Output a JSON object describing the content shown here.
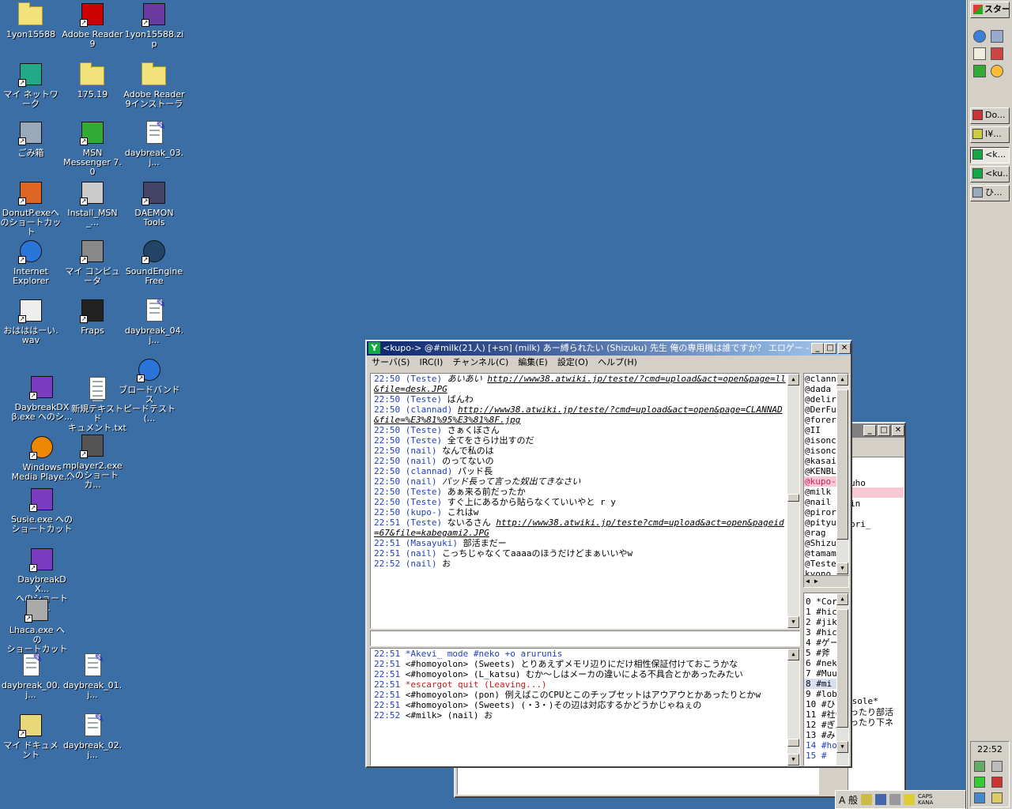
{
  "desktop": {
    "icons": [
      {
        "id": "i0",
        "label": "1yon15588",
        "type": "folder"
      },
      {
        "id": "i1",
        "label": "Adobe Reader\n9",
        "type": "pdf"
      },
      {
        "id": "i2",
        "label": "1yon15588.zip",
        "type": "zip"
      },
      {
        "id": "i3",
        "label": "マイ ネットワーク",
        "type": "network"
      },
      {
        "id": "i4",
        "label": "175.19",
        "type": "folder"
      },
      {
        "id": "i5",
        "label": "Adobe Reader\n9インストーラ",
        "type": "folder"
      },
      {
        "id": "i6",
        "label": "ごみ箱",
        "type": "trash"
      },
      {
        "id": "i7",
        "label": "MSN\nMessenger 7.0",
        "type": "msn"
      },
      {
        "id": "i8",
        "label": "daybreak_03.j...",
        "type": "image"
      },
      {
        "id": "i9",
        "label": "DonutP.exeへ\nのショートカット",
        "type": "donut"
      },
      {
        "id": "i10",
        "label": "Install_MSN_...",
        "type": "installer"
      },
      {
        "id": "i11",
        "label": "DAEMON\nTools",
        "type": "daemon"
      },
      {
        "id": "i12",
        "label": "Internet\nExplorer",
        "type": "ie"
      },
      {
        "id": "i13",
        "label": "マイ コンピュータ",
        "type": "computer"
      },
      {
        "id": "i14",
        "label": "SoundEngine\nFree",
        "type": "sound"
      },
      {
        "id": "i15",
        "label": "おはははーい.\nwav",
        "type": "wav"
      },
      {
        "id": "i16",
        "label": "Fraps",
        "type": "fraps"
      },
      {
        "id": "i17",
        "label": "daybreak_04.j...",
        "type": "image"
      },
      {
        "id": "i18",
        "label": "DaybreakDX\nβ.exe へのシ...",
        "type": "anime"
      },
      {
        "id": "i19",
        "label": "新規テキスト ド\nキュメント.txt",
        "type": "text"
      },
      {
        "id": "i20",
        "label": "ブロードバンドス\nピードテスト(...",
        "type": "ie"
      },
      {
        "id": "i21",
        "label": "Windows\nMedia Playe...",
        "type": "wmp"
      },
      {
        "id": "i22",
        "label": "mplayer2.exe\nへのショートカ...",
        "type": "mplayer"
      },
      {
        "id": "i23",
        "label": "Susie.exe への\nショートカット",
        "type": "anime"
      },
      {
        "id": "i24",
        "label": "DaybreakDX...\nへのショートカ...",
        "type": "anime"
      },
      {
        "id": "i25",
        "label": "Lhaca.exe への\nショートカット",
        "type": "lhaca"
      },
      {
        "id": "i26",
        "label": "daybreak_00.j...",
        "type": "image"
      },
      {
        "id": "i27",
        "label": "daybreak_01.j...",
        "type": "image"
      },
      {
        "id": "i28",
        "label": "マイ ドキュメント",
        "type": "mydocs"
      },
      {
        "id": "i29",
        "label": "daybreak_02.j...",
        "type": "image"
      }
    ]
  },
  "taskbar": {
    "start_label": "スタート",
    "buttons": [
      "Do...",
      "I¥...",
      "<k...",
      "<ku...",
      "ひ..."
    ],
    "clock": "22:52",
    "ime": "A 般",
    "caps": "CAPS",
    "kana": "KANA"
  },
  "chat": {
    "title": "<kupo-> @#milk(21人) [+sn] (milk) あー縛られたい (Shizuku) 先生 俺の専用機は誰ですか？ エロゲー - Li...",
    "menu": [
      "サーバ(S)",
      "IRC(I)",
      "チャンネル(C)",
      "編集(E)",
      "設定(O)",
      "ヘルプ(H)"
    ],
    "main_log": [
      {
        "t": "22:50",
        "n": "(Teste)",
        "m": "あいあい ",
        "u": "http://www38.atwiki.jp/teste/?cmd=upload&act=open&page=ll&file=desk.JPG",
        "st": "it"
      },
      {
        "t": "22:50",
        "n": "(Teste)",
        "m": "ばんわ"
      },
      {
        "t": "22:50",
        "n": "(clannad)",
        "m": "",
        "u": "http://www38.atwiki.jp/teste/?cmd=upload&act=open&page=CLANNAD&file=%E3%81%95%E3%81%8F.jpg"
      },
      {
        "t": "22:50",
        "n": "(Teste)",
        "m": "さぁくぼさん"
      },
      {
        "t": "22:50",
        "n": "(Teste)",
        "m": "全てをさらけ出すのだ"
      },
      {
        "t": "22:50",
        "n": "(nail)",
        "m": "なんで私のは"
      },
      {
        "t": "22:50",
        "n": "(nail)",
        "m": "のってないの"
      },
      {
        "t": "22:50",
        "n": "(clannad)",
        "m": "パッド長"
      },
      {
        "t": "22:50",
        "n": "(nail)",
        "m": "パッド長って言った奴出てきなさい",
        "st": "it"
      },
      {
        "t": "22:50",
        "n": "(Teste)",
        "m": "あぁ来る前だったか"
      },
      {
        "t": "22:50",
        "n": "(Teste)",
        "m": "すぐ上にあるから貼らなくていいやと r y"
      },
      {
        "t": "22:50",
        "n": "(kupo-)",
        "m": "これはw"
      },
      {
        "t": "22:51",
        "n": "(Teste)",
        "m": "ないるさん ",
        "u": "http://www38.atwiki.jp/teste?cmd=upload&act=open&pageid=67&file=kabegami2.JPG"
      },
      {
        "t": "22:51",
        "n": "(Masayuki)",
        "m": "部活まだー"
      },
      {
        "t": "22:51",
        "n": "(nail)",
        "m": "こっちじゃなくてaaaaのほうだけどまぁいいやw"
      },
      {
        "t": "22:52",
        "n": "(nail)",
        "m": "お"
      }
    ],
    "sub_log": [
      {
        "t": "22:51",
        "m": "*Akevi_ mode #neko +o arurunis",
        "cls": "nk"
      },
      {
        "t": "22:51",
        "m": "<#homoyolon> (Sweets) とりあえずメモリ辺りにだけ相性保証付けておこうかな"
      },
      {
        "t": "22:51",
        "m": "<#homoyolon> (L_katsu) むか～しはメーカの違いによる不具合とかあったみたい"
      },
      {
        "t": "22:51",
        "m": "*escargot quit (Leaving...)",
        "cls": "red"
      },
      {
        "t": "22:51",
        "m": "<#homoyolon> (pon) 例えばこのCPUとこのチップセットはアウアウとかあったりとかw"
      },
      {
        "t": "22:51",
        "m": "<#homoyolon> (Sweets) (・3・)その辺は対応するかどうかじゃねぇの"
      },
      {
        "t": "22:52",
        "m": "<#milk> (nail) お"
      }
    ],
    "nicks": [
      "@clann",
      "@dada",
      "@delir",
      "@DerFu",
      "@forer",
      "@II",
      "@isonc",
      "@isonc",
      "@kasai",
      "@KENBL",
      "@kupo-",
      "@milk",
      "@nail",
      "@piror",
      "@pityu",
      "@rag",
      "@Shizu",
      "@tamam",
      "@Teste",
      " kyono"
    ],
    "nick_highlight": "@kupo-",
    "channels": [
      "0 *Cor",
      "1 #hic",
      "2 #jik",
      "3 #hic",
      "4 #ゲー",
      "5 #斧",
      "6 #nek",
      "7 #Muu",
      "8 #mi",
      "9 #lob",
      "10 #ひう",
      "11 #社会",
      "12 #ぎん",
      "13 #み",
      "14 #hom",
      "15 #"
    ],
    "channel_selected": "8 #mi"
  },
  "back_window": {
    "lines": [
      "uho",
      "in",
      "ori_",
      "nsole*",
      "ったり部活",
      "ったり下ネ"
    ],
    "highlight": ""
  }
}
